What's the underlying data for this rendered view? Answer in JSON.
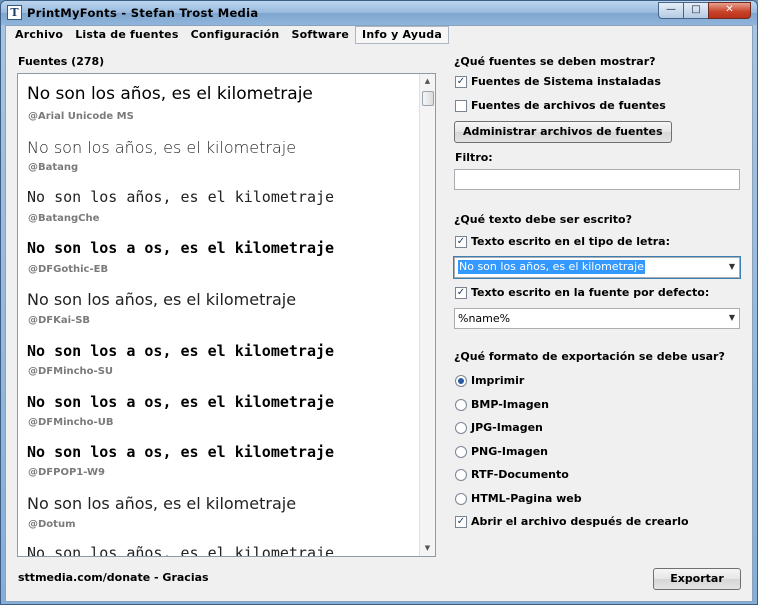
{
  "window": {
    "title": "PrintMyFonts - Stefan Trost Media",
    "app_icon_glyph": "T"
  },
  "window_controls": {
    "minimize": "—",
    "maximize": "□",
    "close": "✕"
  },
  "menu": [
    "Archivo",
    "Lista de fuentes",
    "Configuración",
    "Software",
    "Info y Ayuda"
  ],
  "font_list": {
    "header": "Fuentes (278)",
    "items": [
      {
        "preview": "No son los años, es el kilometraje",
        "font": "@Arial Unicode MS"
      },
      {
        "preview": "No son los años, es el kilometraje",
        "font": "@Batang"
      },
      {
        "preview": "No son los años, es el kilometraje",
        "font": "@BatangChe"
      },
      {
        "preview": "No son los a  os, es el kilometraje",
        "font": "@DFGothic-EB"
      },
      {
        "preview": "No son los años, es el kilometraje",
        "font": "@DFKai-SB"
      },
      {
        "preview": "No son los a  os, es el kilometraje",
        "font": "@DFMincho-SU"
      },
      {
        "preview": "No son los a  os, es el kilometraje",
        "font": "@DFMincho-UB"
      },
      {
        "preview": "No son los a  os, es el kilometraje",
        "font": "@DFPOP1-W9"
      },
      {
        "preview": "No son los años, es el kilometraje",
        "font": "@Dotum"
      },
      {
        "preview": "No son los años, es el kilometraje",
        "font": ""
      }
    ],
    "scroll_up": "▲",
    "scroll_down": "▼"
  },
  "fonts_section": {
    "title": "¿Qué fuentes se deben mostrar?",
    "system_fonts_label": "Fuentes de Sistema instaladas",
    "system_fonts_checked": true,
    "file_fonts_label": "Fuentes de archivos de fuentes",
    "file_fonts_checked": false,
    "manage_button": "Administrar archivos de fuentes",
    "filter_label": "Filtro:",
    "filter_value": ""
  },
  "text_section": {
    "title": "¿Qué texto debe ser escrito?",
    "font_text_label": "Texto escrito en el tipo de letra:",
    "font_text_checked": true,
    "font_text_value": "No son los años, es el kilometraje",
    "default_text_label": "Texto escrito en la fuente por defecto:",
    "default_text_checked": true,
    "default_text_value": "%name%"
  },
  "export_section": {
    "title": "¿Qué formato de exportación se debe usar?",
    "options": [
      {
        "label": "Imprimir",
        "selected": true
      },
      {
        "label": "BMP-Imagen",
        "selected": false
      },
      {
        "label": "JPG-Imagen",
        "selected": false
      },
      {
        "label": "PNG-Imagen",
        "selected": false
      },
      {
        "label": "RTF-Documento",
        "selected": false
      },
      {
        "label": "HTML-Pagina web",
        "selected": false
      }
    ],
    "open_after_label": "Abrir el archivo después de crearlo",
    "open_after_checked": true
  },
  "footer": {
    "donate_text": "sttmedia.com/donate - Gracias",
    "export_button": "Exportar"
  },
  "icons": {
    "check": "✓",
    "dropdown": "▼"
  }
}
